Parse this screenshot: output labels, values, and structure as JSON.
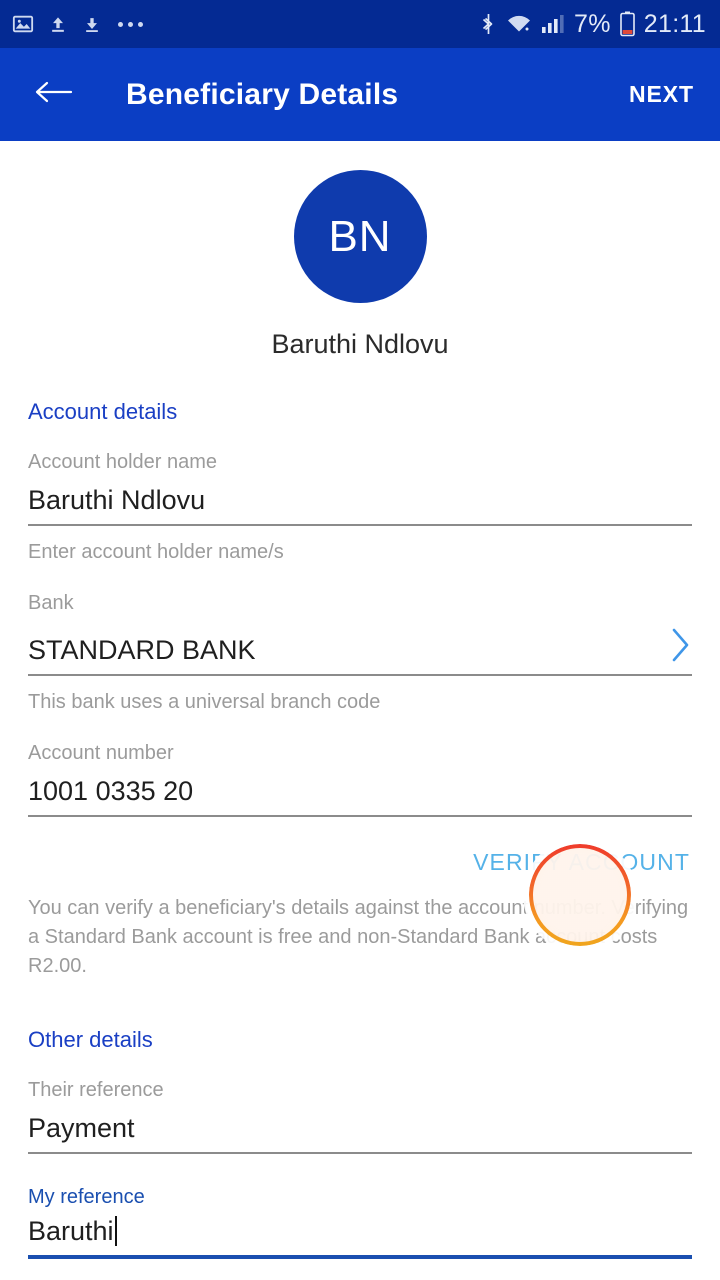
{
  "status_bar": {
    "left_icons": [
      "image-icon",
      "upload-icon",
      "download-icon",
      "more-dots-icon"
    ],
    "right_icons": [
      "bluetooth-icon",
      "wifi-icon",
      "signal-icon",
      "battery-icon"
    ],
    "battery_percent": "7%",
    "time": "21:11"
  },
  "app_bar": {
    "back_icon": "back-arrow-icon",
    "title": "Beneficiary Details",
    "next_label": "NEXT",
    "background_color": "#0b3ec4"
  },
  "beneficiary": {
    "initials": "BN",
    "name": "Baruthi Ndlovu",
    "avatar_color": "#0f3bad"
  },
  "account_details": {
    "section_title": "Account details",
    "fields": [
      {
        "label": "Account holder name",
        "value": "Baruthi Ndlovu",
        "helper": "Enter account holder name/s"
      },
      {
        "label": "Bank",
        "value": "STANDARD BANK",
        "helper": "This bank uses a universal branch code",
        "chevron_icon": "chevron-right-icon"
      },
      {
        "label": "Account number",
        "value": "1001 0335 20"
      }
    ],
    "verify_label": "VERIFY ACCOUNT",
    "verify_color": "#55b2e8",
    "verify_note": "You can verify a beneficiary's details against the account number. Verifying a Standard Bank account is free and non-Standard Bank account costs R2.00."
  },
  "other_details": {
    "section_title": "Other details",
    "fields": [
      {
        "label": "Their reference",
        "value": "Payment"
      },
      {
        "label": "My reference",
        "value": "Baruthi",
        "focused": true
      }
    ]
  },
  "tap_highlight": {
    "target": "verify-account-button",
    "ring_color": "#f0781f"
  }
}
